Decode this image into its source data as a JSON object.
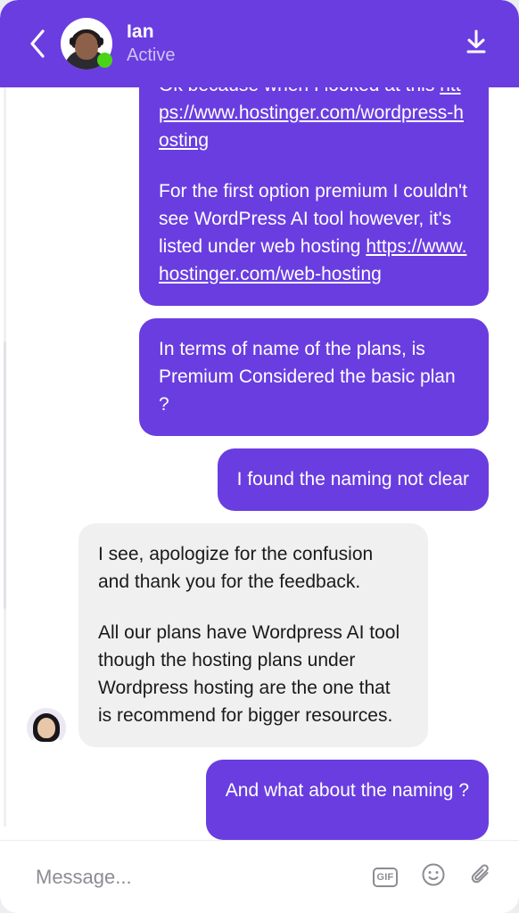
{
  "theme": {
    "accent": "#6A3DE0",
    "incoming_bubble": "#f0f0f0",
    "page_background": "#eceef1",
    "online_dot": "#49D419",
    "header_status_color": "#cfc2f4"
  },
  "header": {
    "back_icon": "chevron-left-icon",
    "avatar": "contact-avatar",
    "name": "Ian",
    "status": "Active",
    "download_icon": "download-icon"
  },
  "conversation": {
    "messages": [
      {
        "id": "msg-1",
        "direction": "out",
        "clipped_top": true,
        "paragraphs": [
          {
            "parts": [
              {
                "type": "text",
                "text": "Ok because when I looked at this "
              },
              {
                "type": "link",
                "text": "https://www.hostinger.com/wordpress-hosting"
              }
            ]
          },
          {
            "parts": [
              {
                "type": "text",
                "text": "For the first option premium I couldn't see WordPress AI tool however, it's listed under web hosting "
              },
              {
                "type": "link",
                "text": "https://www.hostinger.com/web-hosting"
              }
            ]
          }
        ]
      },
      {
        "id": "msg-2",
        "direction": "out",
        "paragraphs": [
          {
            "parts": [
              {
                "type": "text",
                "text": "In terms of name of the plans, is Premium Considered the basic plan ?"
              }
            ]
          }
        ]
      },
      {
        "id": "msg-3",
        "direction": "out",
        "paragraphs": [
          {
            "parts": [
              {
                "type": "text",
                "text": "I found the naming not clear"
              }
            ]
          }
        ]
      },
      {
        "id": "msg-4",
        "direction": "in",
        "avatar": "agent-avatar",
        "paragraphs": [
          {
            "parts": [
              {
                "type": "text",
                "text": "I see, apologize for the confusion and thank you for the feedback."
              }
            ]
          },
          {
            "parts": [
              {
                "type": "text",
                "text": "All our plans have Wordpress AI tool though the hosting plans under Wordpress hosting are the one that is recommend for bigger resources."
              }
            ]
          }
        ]
      },
      {
        "id": "msg-5",
        "direction": "out",
        "clipped_bottom": true,
        "paragraphs": [
          {
            "parts": [
              {
                "type": "text",
                "text": "And what about the naming ?"
              }
            ]
          }
        ]
      }
    ]
  },
  "composer": {
    "placeholder": "Message...",
    "value": "",
    "gif_label": "GIF",
    "gif_icon": "gif-icon",
    "emoji_icon": "smiley-icon",
    "attachment_icon": "paperclip-icon"
  }
}
